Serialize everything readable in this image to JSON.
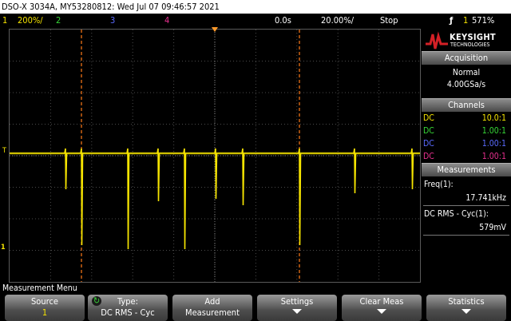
{
  "title_bar": "DSO-X 3034A, MY53280812: Wed Jul 07 09:46:57 2021",
  "status_bar": {
    "ch1_num": "1",
    "ch1_scale": "200%/",
    "ch2_num": "2",
    "ch3_num": "3",
    "ch4_num": "4",
    "delay": "0.0s",
    "timebase": "20.00%/",
    "run_state": "Stop",
    "trigger_icon": "trigger-edge-icon",
    "trig_channel": "1",
    "trig_level": "571%"
  },
  "colors": {
    "ch1": "#f5e400",
    "ch2": "#37d737",
    "ch3": "#5a6bff",
    "ch4": "#e8308f",
    "cursor": "#ff7a18",
    "accent": "#d32026"
  },
  "brand": {
    "name": "KEYSIGHT",
    "sub": "TECHNOLOGIES"
  },
  "acquisition": {
    "header": "Acquisition",
    "mode": "Normal",
    "rate": "4.00GSa/s"
  },
  "channels": {
    "header": "Channels",
    "rows": [
      {
        "coupling": "DC",
        "probe": "10.0:1"
      },
      {
        "coupling": "DC",
        "probe": "1.00:1"
      },
      {
        "coupling": "DC",
        "probe": "1.00:1"
      },
      {
        "coupling": "DC",
        "probe": "1.00:1"
      }
    ]
  },
  "measurements": {
    "header": "Measurements",
    "items": [
      {
        "label": "Freq(1):",
        "value": "17.741kHz"
      },
      {
        "label": "DC RMS - Cyc(1):",
        "value": "579mV"
      }
    ]
  },
  "menu_title": "Measurement Menu",
  "softkeys": [
    {
      "line1": "Source",
      "line2": "1"
    },
    {
      "line1": "Type:",
      "line2": "DC RMS - Cyc"
    },
    {
      "line1": "Add",
      "line2": "Measurement"
    },
    {
      "line1": "Settings",
      "line2": ""
    },
    {
      "line1": "Clear Meas",
      "line2": ""
    },
    {
      "line1": "Statistics",
      "line2": ""
    }
  ],
  "screen_markers": {
    "trigger_level_marker": "T",
    "ground_marker": "1"
  }
}
